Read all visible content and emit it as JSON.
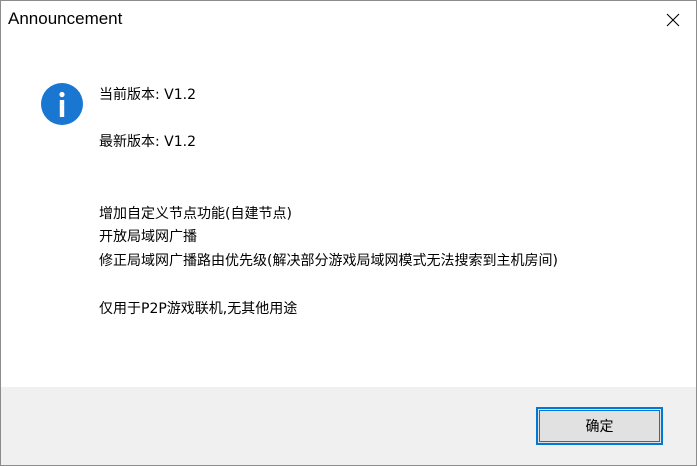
{
  "window": {
    "title": "Announcement"
  },
  "message": {
    "current_version": "当前版本: V1.2",
    "latest_version": "最新版本: V1.2",
    "changes": [
      "增加自定义节点功能(自建节点)",
      "开放局域网广播",
      "修正局域网广播路由优先级(解决部分游戏局域网模式无法搜索到主机房间)"
    ],
    "note": "仅用于P2P游戏联机,无其他用途"
  },
  "buttons": {
    "ok_label": "确定"
  },
  "icons": {
    "info": "info-icon",
    "close": "close-icon"
  },
  "colors": {
    "accent": "#0078d7",
    "info_icon": "#1977d2",
    "footer_bg": "#f0f0f0"
  }
}
